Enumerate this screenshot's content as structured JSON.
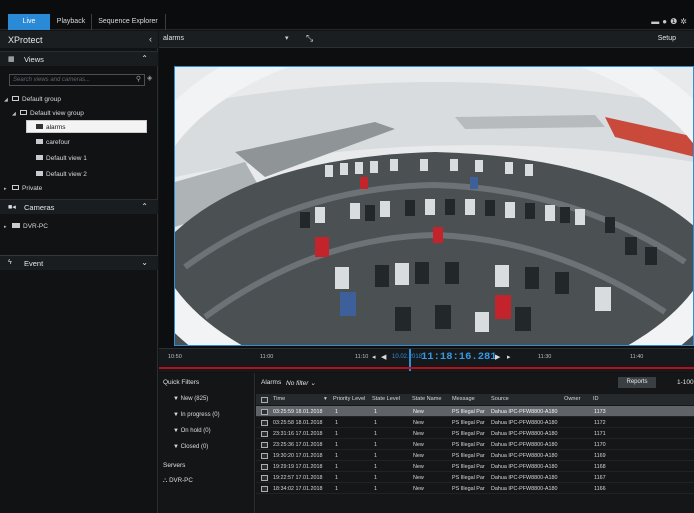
{
  "app": {
    "tabs": [
      "Live",
      "Playback",
      "Sequence Explorer"
    ],
    "active_tab": "Live",
    "brand": "XProtect",
    "accent_color": "#2b8ad6",
    "top_icons": [
      "monitor-icon",
      "record-icon",
      "info-icon",
      "settings-icon"
    ]
  },
  "sidebar": {
    "views_header": "Views",
    "search_placeholder": "Search views and cameras...",
    "tree": {
      "default_group": "Default group",
      "default_view_group": "Default view group",
      "views": [
        "alarms",
        "carefour",
        "Default view 1",
        "Default view 2"
      ],
      "selected_view": "alarms",
      "private": "Private"
    },
    "cameras_header": "Cameras",
    "camera_server": "DVR-PC",
    "event_header": "Event"
  },
  "viewbar": {
    "view_name": "alarms",
    "setup_label": "Setup"
  },
  "timeline": {
    "ticks": [
      "10:50",
      "11:00",
      "11:10",
      "11:30",
      "11:40"
    ],
    "date": "10.02.2018",
    "time": "11:18:16.281",
    "marker_color": "#b3121b"
  },
  "quick_filters": {
    "title": "Quick Filters",
    "items": [
      "New (825)",
      "In progress (0)",
      "On hold (0)",
      "Closed (0)"
    ],
    "servers_title": "Servers",
    "server": "DVR-PC"
  },
  "alarms": {
    "title": "Alarms",
    "filter": "No filter",
    "reports_label": "Reports",
    "range_label": "1-100",
    "columns": [
      "Time",
      "Priority Level",
      "State Level",
      "State Name",
      "Message",
      "Source",
      "Owner",
      "ID"
    ],
    "rows": [
      {
        "time": "03:25:59 18.01.2018",
        "priority": "1",
        "state_level": "1",
        "state_name": "New",
        "message": "PS Illegal Par",
        "source": "Dahua IPC-PFW8800-A180",
        "owner": "",
        "id": "1173",
        "selected": true
      },
      {
        "time": "03:25:58 18.01.2018",
        "priority": "1",
        "state_level": "1",
        "state_name": "New",
        "message": "PS Illegal Par",
        "source": "Dahua IPC-PFW8800-A180",
        "owner": "",
        "id": "1172",
        "selected": false
      },
      {
        "time": "23:31:16 17.01.2018",
        "priority": "1",
        "state_level": "1",
        "state_name": "New",
        "message": "PS Illegal Par",
        "source": "Dahua IPC-PFW8800-A180",
        "owner": "",
        "id": "1171",
        "selected": false
      },
      {
        "time": "23:25:36 17.01.2018",
        "priority": "1",
        "state_level": "1",
        "state_name": "New",
        "message": "PS Illegal Par",
        "source": "Dahua IPC-PFW8800-A180",
        "owner": "",
        "id": "1170",
        "selected": false
      },
      {
        "time": "19:30:20 17.01.2018",
        "priority": "1",
        "state_level": "1",
        "state_name": "New",
        "message": "PS Illegal Par",
        "source": "Dahua IPC-PFW8800-A180",
        "owner": "",
        "id": "1169",
        "selected": false
      },
      {
        "time": "19:29:19 17.01.2018",
        "priority": "1",
        "state_level": "1",
        "state_name": "New",
        "message": "PS Illegal Par",
        "source": "Dahua IPC-PFW8800-A180",
        "owner": "",
        "id": "1168",
        "selected": false
      },
      {
        "time": "19:22:57 17.01.2018",
        "priority": "1",
        "state_level": "1",
        "state_name": "New",
        "message": "PS Illegal Par",
        "source": "Dahua IPC-PFW8800-A180",
        "owner": "",
        "id": "1167",
        "selected": false
      },
      {
        "time": "18:34:02 17.01.2018",
        "priority": "1",
        "state_level": "1",
        "state_name": "New",
        "message": "PS Illegal Par",
        "source": "Dahua IPC-PFW8800-A180",
        "owner": "",
        "id": "1166",
        "selected": false
      }
    ]
  }
}
